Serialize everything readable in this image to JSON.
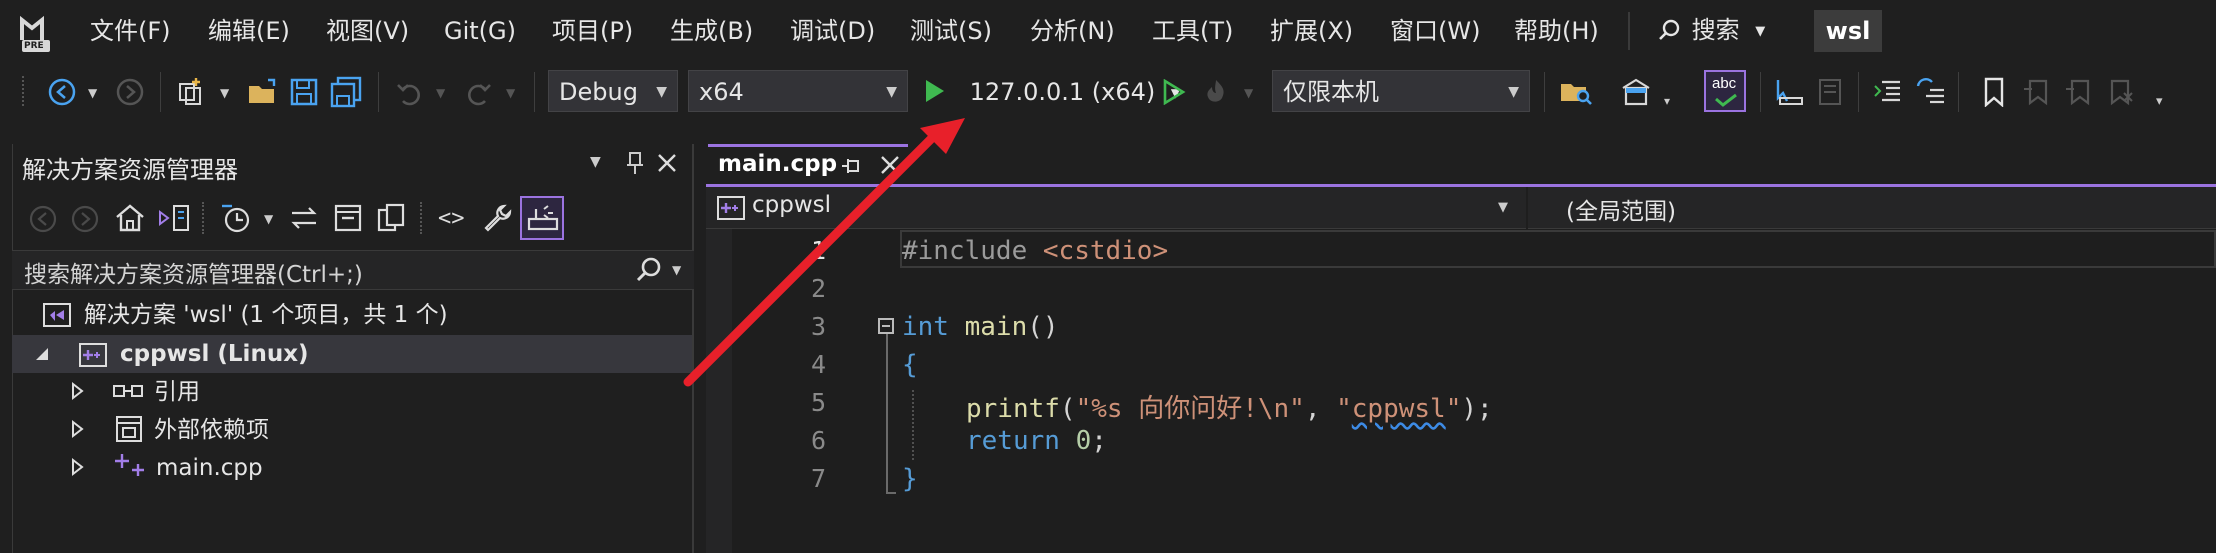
{
  "menu": {
    "items": [
      "文件(F)",
      "编辑(E)",
      "视图(V)",
      "Git(G)",
      "项目(P)",
      "生成(B)",
      "调试(D)",
      "测试(S)",
      "分析(N)",
      "工具(T)",
      "扩展(X)",
      "窗口(W)",
      "帮助(H)"
    ],
    "search_label": "搜索",
    "solution_badge": "wsl",
    "logo_text": "PRE"
  },
  "toolbar": {
    "configuration": "Debug",
    "platform": "x64",
    "run_target": "127.0.0.1 (x64)",
    "startup_scope": "仅限本机"
  },
  "solution_explorer": {
    "title": "解决方案资源管理器",
    "search_placeholder": "搜索解决方案资源管理器(Ctrl+;)",
    "tree": {
      "solution": "解决方案 'wsl' (1 个项目，共 1 个)",
      "project": "cppwsl (Linux)",
      "references": "引用",
      "external_deps": "外部依赖项",
      "file": "main.cpp"
    }
  },
  "editor": {
    "tab_title": "main.cpp",
    "nav_project": "cppwsl",
    "nav_scope": "(全局范围)",
    "line_numbers": [
      "1",
      "2",
      "3",
      "4",
      "5",
      "6",
      "7"
    ],
    "code": {
      "l1_directive": "#include",
      "l1_header": "<cstdio>",
      "l3_type": "int",
      "l3_name": "main",
      "l3_parens": "()",
      "l4": "{",
      "l5_fn": "printf",
      "l5_open": "(",
      "l5_fmt": "\"%s 向你问好!\\n\"",
      "l5_comma": ", ",
      "l5_q1": "\"",
      "l5_arg": "cppwsl",
      "l5_q2": "\"",
      "l5_close": ");",
      "l6_kw": "return",
      "l6_val": "0",
      "l6_end": ";",
      "l7": "}"
    }
  },
  "annotation": {
    "arrow_color": "#e8202a"
  },
  "colors": {
    "accent": "#9b73e0",
    "run_green": "#3fb950",
    "icon_blue": "#4aa3f0"
  }
}
